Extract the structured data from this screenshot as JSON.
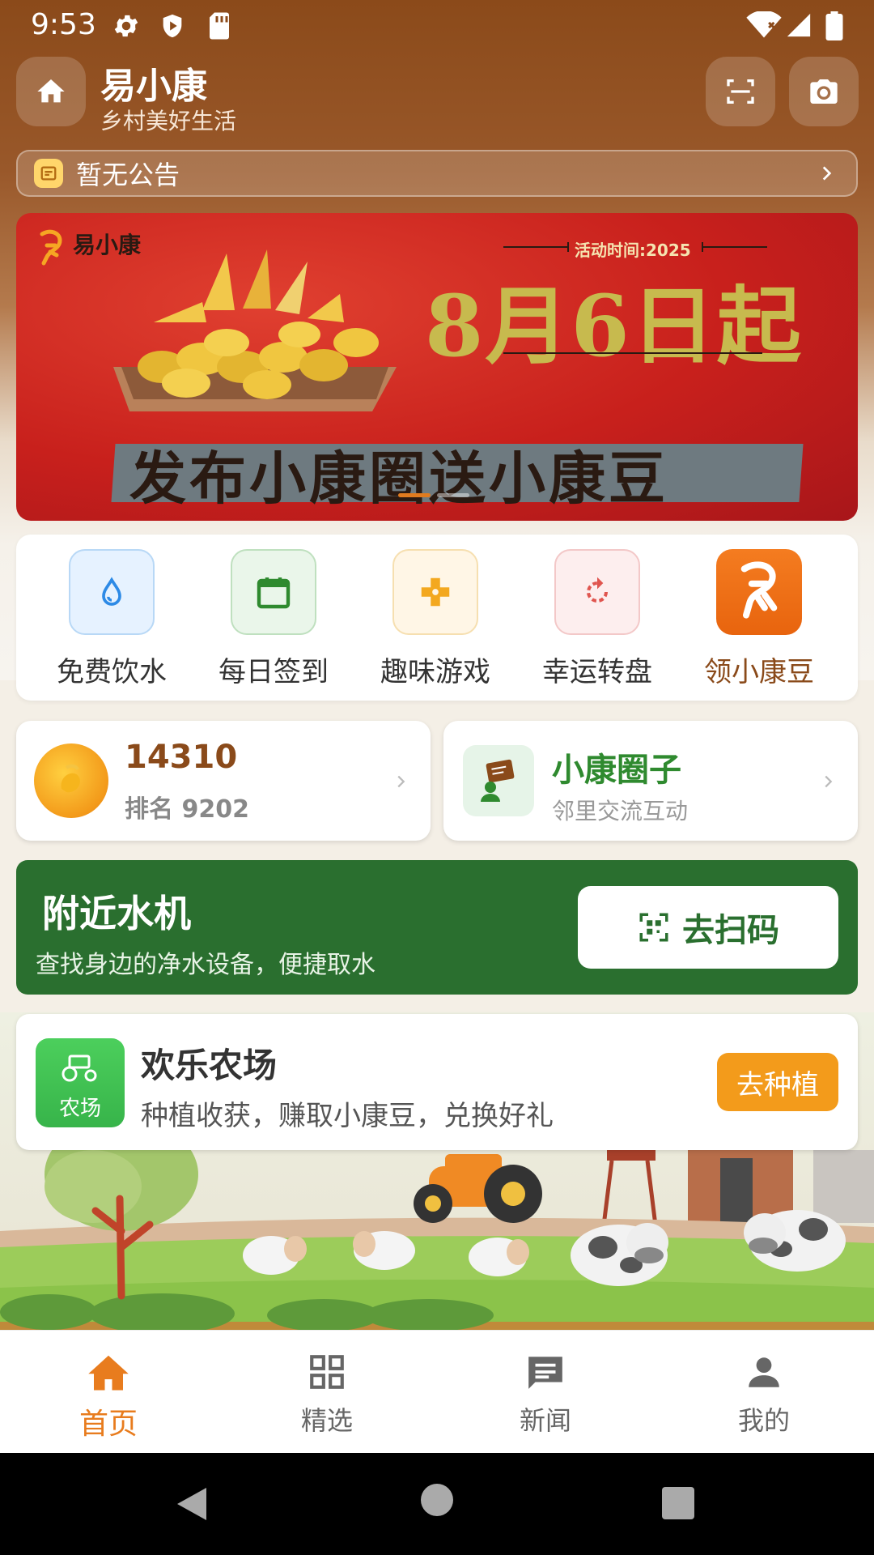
{
  "status_bar": {
    "time": "9:53"
  },
  "header": {
    "title": "易小康",
    "subtitle": "乡村美好生活"
  },
  "notice": {
    "text": "暂无公告"
  },
  "banner": {
    "logo_text": "易小康",
    "date_label": "活动时间:2025",
    "date_big": "8月6日起",
    "slogan": "发布小康圈送小康豆"
  },
  "quick_actions": [
    {
      "label": "免费饮水",
      "icon": "water-drop-icon"
    },
    {
      "label": "每日签到",
      "icon": "calendar-icon"
    },
    {
      "label": "趣味游戏",
      "icon": "gamepad-icon"
    },
    {
      "label": "幸运转盘",
      "icon": "spin-wheel-icon"
    },
    {
      "label": "领小康豆",
      "icon": "bean-logo-icon"
    }
  ],
  "points": {
    "value": "14310",
    "rank": "排名 9202"
  },
  "circle": {
    "title": "小康圈子",
    "subtitle": "邻里交流互动"
  },
  "water_machine": {
    "title": "附近水机",
    "subtitle": "查找身边的净水设备，便捷取水",
    "button": "去扫码"
  },
  "farm": {
    "icon_label": "农场",
    "title": "欢乐农场",
    "subtitle": "种植收获，赚取小康豆，兑换好礼",
    "button": "去种植"
  },
  "bottom_nav": [
    {
      "label": "首页",
      "icon": "home-icon",
      "active": true
    },
    {
      "label": "精选",
      "icon": "grid-icon",
      "active": false
    },
    {
      "label": "新闻",
      "icon": "message-icon",
      "active": false
    },
    {
      "label": "我的",
      "icon": "person-icon",
      "active": false
    }
  ],
  "colors": {
    "brand_brown": "#8b4a1a",
    "accent_orange": "#e87c1e",
    "green": "#2a6f2f"
  }
}
